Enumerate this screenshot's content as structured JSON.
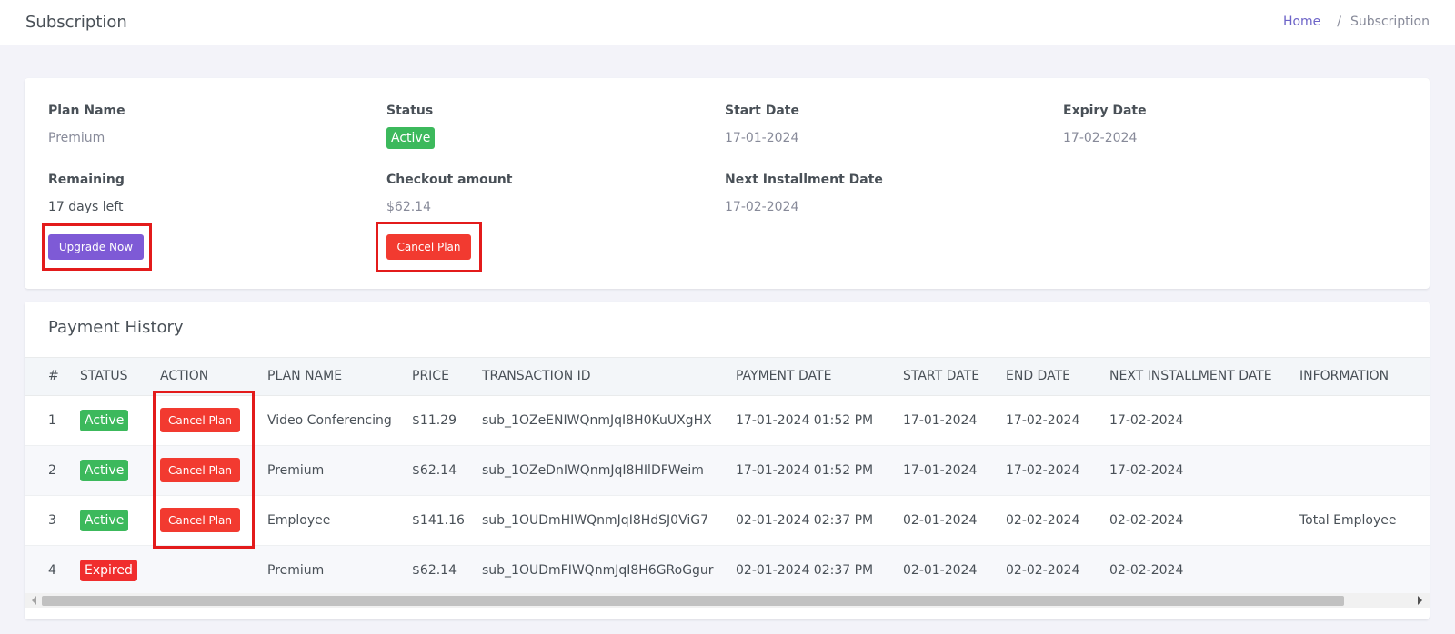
{
  "header": {
    "title": "Subscription",
    "breadcrumb": {
      "home": "Home",
      "separator": "/",
      "current": "Subscription"
    }
  },
  "plan": {
    "plan_name_label": "Plan Name",
    "plan_name": "Premium",
    "status_label": "Status",
    "status": "Active",
    "start_date_label": "Start Date",
    "start_date": "17-01-2024",
    "expiry_date_label": "Expiry Date",
    "expiry_date": "17-02-2024",
    "remaining_label": "Remaining",
    "remaining": "17 days left",
    "checkout_label": "Checkout amount",
    "checkout_amount": "$62.14",
    "next_installment_label": "Next Installment Date",
    "next_installment": "17-02-2024",
    "upgrade_button": "Upgrade Now",
    "cancel_button": "Cancel Plan"
  },
  "history": {
    "title": "Payment History",
    "columns": [
      "#",
      "STATUS",
      "ACTION",
      "PLAN NAME",
      "PRICE",
      "TRANSACTION ID",
      "PAYMENT DATE",
      "START DATE",
      "END DATE",
      "NEXT INSTALLMENT DATE",
      "INFORMATION"
    ],
    "rows": [
      {
        "num": "1",
        "status": "Active",
        "action": "Cancel Plan",
        "plan": "Video Conferencing",
        "price": "$11.29",
        "txn": "sub_1OZeENIWQnmJqI8H0KuUXgHX",
        "payment_date": "17-01-2024 01:52 PM",
        "start": "17-01-2024",
        "end": "17-02-2024",
        "next": "17-02-2024",
        "info": ""
      },
      {
        "num": "2",
        "status": "Active",
        "action": "Cancel Plan",
        "plan": "Premium",
        "price": "$62.14",
        "txn": "sub_1OZeDnIWQnmJqI8HIlDFWeim",
        "payment_date": "17-01-2024 01:52 PM",
        "start": "17-01-2024",
        "end": "17-02-2024",
        "next": "17-02-2024",
        "info": ""
      },
      {
        "num": "3",
        "status": "Active",
        "action": "Cancel Plan",
        "plan": "Employee",
        "price": "$141.16",
        "txn": "sub_1OUDmHIWQnmJqI8HdSJ0ViG7",
        "payment_date": "02-01-2024 02:37 PM",
        "start": "02-01-2024",
        "end": "02-02-2024",
        "next": "02-02-2024",
        "info": "Total Employee"
      },
      {
        "num": "4",
        "status": "Expired",
        "action": "",
        "plan": "Premium",
        "price": "$62.14",
        "txn": "sub_1OUDmFIWQnmJqI8H6GRoGgur",
        "payment_date": "02-01-2024 02:37 PM",
        "start": "02-01-2024",
        "end": "02-02-2024",
        "next": "02-02-2024",
        "info": ""
      }
    ]
  },
  "colors": {
    "active": "#3cb95c",
    "expired": "#f02d2d",
    "cancel": "#f23a30",
    "upgrade": "#7e5ad6",
    "highlight": "#e31b1b"
  }
}
